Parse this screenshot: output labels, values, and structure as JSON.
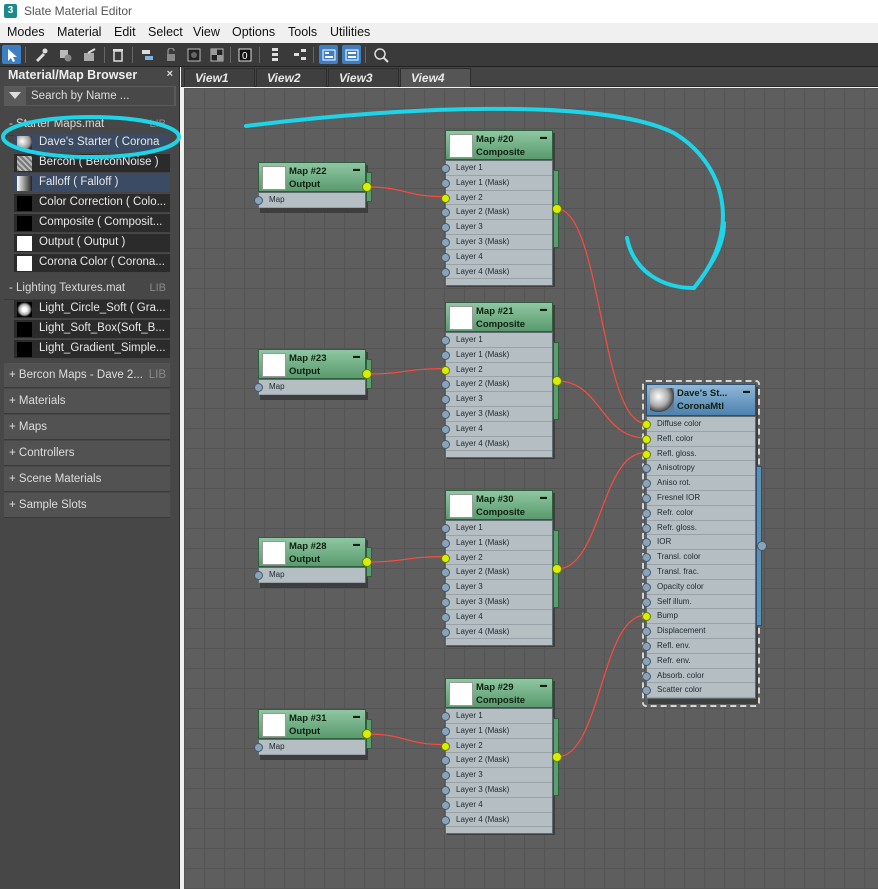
{
  "window": {
    "app_icon": "3",
    "title": "Slate Material Editor"
  },
  "menu": [
    "Modes",
    "Material",
    "Edit",
    "Select",
    "View",
    "Options",
    "Tools",
    "Utilities"
  ],
  "toolbar_icons": [
    "select-arrow-icon",
    "eyedropper-icon",
    "assign-material-icon",
    "pick-material-icon",
    "delete-icon",
    "move-children-icon",
    "hide-unused-icon",
    "background-icon",
    "checker-icon",
    "material-id-icon",
    "layout-all-icon",
    "layout-children-icon",
    "show-navigator-icon",
    "show-params-icon",
    "nav-pan-icon"
  ],
  "browser": {
    "title": "Material/Map Browser",
    "close": "×",
    "search_placeholder": "Search by Name ...",
    "groups": [
      {
        "label": "- Starter Maps.mat",
        "lib": "LIB",
        "items": [
          {
            "label": "Dave's Starter  ( Corona",
            "swatch": "sphere",
            "selected": true
          },
          {
            "label": "Bercon  ( BerconNoise )",
            "swatch": "noise"
          },
          {
            "label": "Falloff  ( Falloff )",
            "swatch": "gradient",
            "selected": true
          },
          {
            "label": "Color Correction  ( Colo...",
            "swatch": "black"
          },
          {
            "label": "Composite  ( Composit...",
            "swatch": "black"
          },
          {
            "label": "Output  ( Output )",
            "swatch": "white"
          },
          {
            "label": "Corona Color  ( Corona...",
            "swatch": "white"
          }
        ]
      },
      {
        "label": "- Lighting Textures.mat",
        "lib": "LIB",
        "items": [
          {
            "label": "Light_Circle_Soft  ( Gra...",
            "swatch": "circle"
          },
          {
            "label": "Light_Soft_Box(Soft_B...",
            "swatch": "black"
          },
          {
            "label": "Light_Gradient_Simple...",
            "swatch": "black"
          }
        ]
      }
    ],
    "collapsed": [
      {
        "label": "+ Bercon Maps - Dave 2...",
        "lib": "LIB"
      },
      {
        "label": "+ Materials"
      },
      {
        "label": "+ Maps"
      },
      {
        "label": "+ Controllers"
      },
      {
        "label": "+ Scene Materials"
      },
      {
        "label": "+ Sample Slots"
      }
    ]
  },
  "views": [
    "View1",
    "View2",
    "View3",
    "View4"
  ],
  "active_view": "View4",
  "nodes": {
    "output_slot": "Map",
    "composite_slots": [
      "Layer 1",
      "Layer 1 (Mask)",
      "Layer 2",
      "Layer 2 (Mask)",
      "Layer 3",
      "Layer 3 (Mask)",
      "Layer 4",
      "Layer 4 (Mask)"
    ],
    "output": [
      {
        "name": "Map #22",
        "type": "Output"
      },
      {
        "name": "Map #23",
        "type": "Output"
      },
      {
        "name": "Map #28",
        "type": "Output"
      },
      {
        "name": "Map #31",
        "type": "Output"
      }
    ],
    "composite": [
      {
        "name": "Map #20",
        "type": "Composite"
      },
      {
        "name": "Map #21",
        "type": "Composite"
      },
      {
        "name": "Map #30",
        "type": "Composite"
      },
      {
        "name": "Map #29",
        "type": "Composite"
      }
    ],
    "material": {
      "name": "Dave's St...",
      "type": "CoronaMtl",
      "slots": [
        "Diffuse color",
        "Refl. color",
        "Refl. gloss.",
        "Anisotropy",
        "Aniso rot.",
        "Fresnel IOR",
        "Refr. color",
        "Refr. gloss.",
        "IOR",
        "Transl. color",
        "Transl. frac.",
        "Opacity color",
        "Self illum.",
        "Bump",
        "Displacement",
        "Refl. env.",
        "Refr. env.",
        "Absorb. color",
        "Scatter color"
      ],
      "connected_slots": [
        "Diffuse color",
        "Refl. color",
        "Refl. gloss.",
        "Bump"
      ]
    }
  },
  "colors": {
    "wire": "#ff4a3d",
    "annotation": "#1ed4e8",
    "connected_socket": "#d8f000",
    "map_node": "#6fae81",
    "material_node": "#5d93c0"
  }
}
